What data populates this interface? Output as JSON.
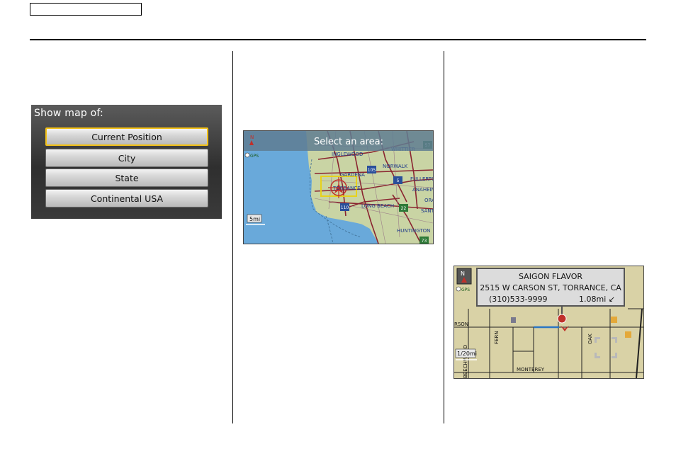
{
  "menu": {
    "title": "Show map of:",
    "options": [
      "Current Position",
      "City",
      "State",
      "Continental USA"
    ],
    "selected_index": 0,
    "highlight_color": "#f2c118"
  },
  "area_map": {
    "prompt": "Select an area:",
    "north_label": "N",
    "gps_label": "GPS",
    "scale": "5mi",
    "cities": [
      "INGLEWOOD",
      "WHITTIER",
      "NORWALK",
      "GARDENA",
      "FULLERTON",
      "TORRANCE",
      "ANAHEIM",
      "LONG BEACH",
      "HUNTINGTON",
      "ORANGE",
      "SANTA ANA"
    ],
    "shields": [
      "105",
      "5",
      "110",
      "22",
      "73",
      "57"
    ],
    "water_color": "#69a9da",
    "land_color": "#c9d4a4"
  },
  "street_map": {
    "north_label": "N",
    "gps_label": "GPS",
    "scale": "1/20mi",
    "popup": {
      "name": "SAIGON FLAVOR",
      "address": "2515 W CARSON ST, TORRANCE, CA",
      "phone": "(310)533-9999",
      "distance": "1.08mi"
    },
    "streets": [
      "RSON",
      "FERN",
      "OAK",
      "MONTEREY",
      "BEECHWOOD"
    ]
  }
}
